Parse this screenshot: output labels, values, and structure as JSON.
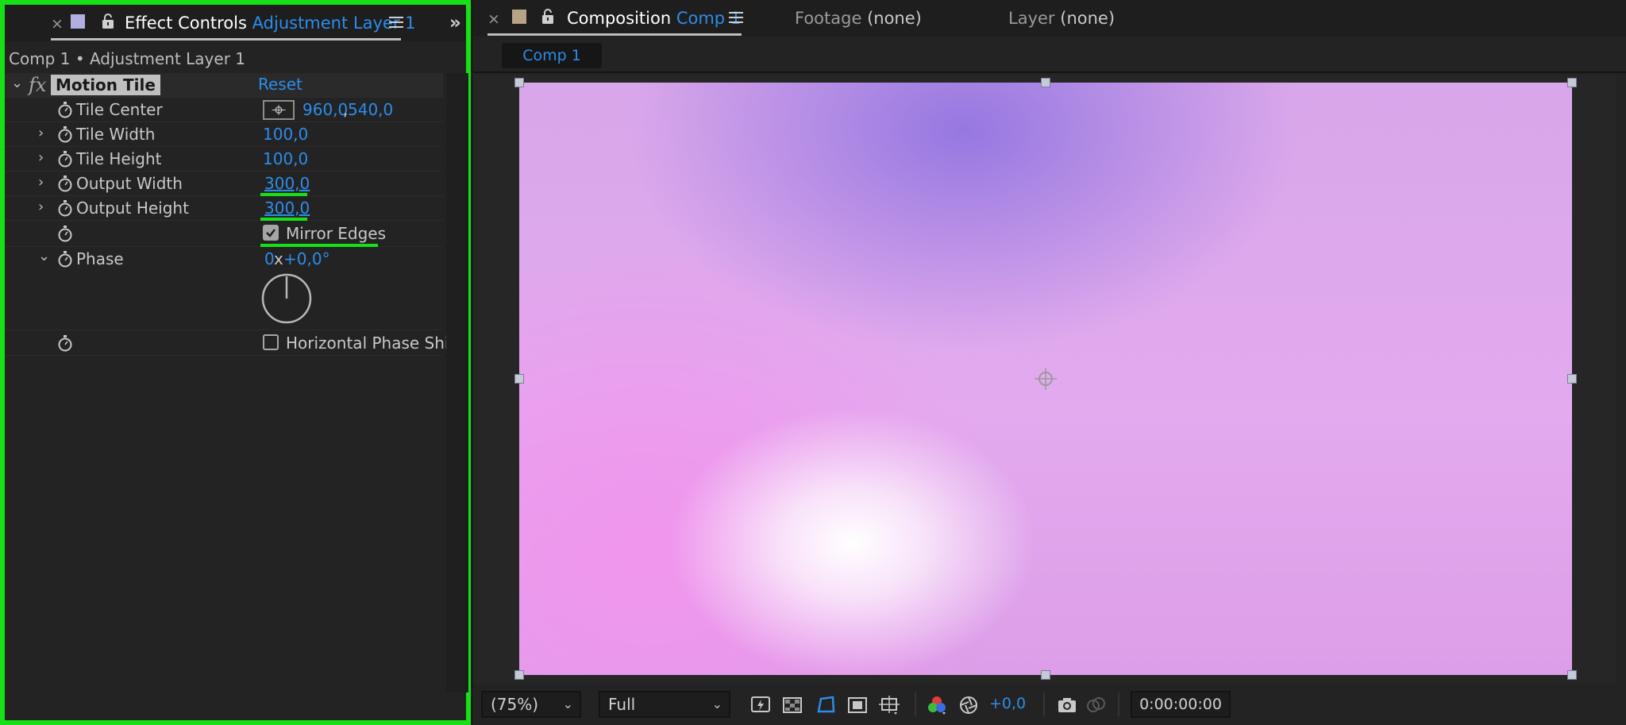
{
  "effect_controls": {
    "tab_close": "×",
    "title_prefix": "Effect Controls",
    "title_layer": "Adjustment Layer 1",
    "layer_path": "Comp 1 • Adjustment Layer 1",
    "overflow": "»",
    "effect": {
      "fx_label": "fx",
      "name": "Motion Tile",
      "reset_label": "Reset"
    },
    "properties": [
      {
        "name": "Tile Center",
        "value_x": "960,0",
        "value_sep": ",",
        "value_y": "540,0"
      },
      {
        "name": "Tile Width",
        "value": "100,0"
      },
      {
        "name": "Tile Height",
        "value": "100,0"
      },
      {
        "name": "Output Width",
        "value": "300,0"
      },
      {
        "name": "Output Height",
        "value": "300,0"
      },
      {
        "name": "",
        "checkbox_label": "Mirror Edges",
        "checked": true
      },
      {
        "name": "Phase",
        "value_rev": "0",
        "value_x": "x",
        "value_deg": "+0,0°"
      },
      {
        "name": "",
        "checkbox_label": "Horizontal Phase Shif",
        "checked": false
      }
    ]
  },
  "composition": {
    "tab_close": "×",
    "title_prefix": "Composition",
    "title_comp": "Comp 1",
    "footage_label": "Footage",
    "footage_value": "(none)",
    "layer_label": "Layer",
    "layer_value": "(none)",
    "subtab": "Comp 1",
    "zoom": "(75%)",
    "resolution": "Full",
    "exposure": "+0,0",
    "timecode": "0:00:00:00"
  },
  "colors": {
    "highlight_border": "#16e016",
    "accent_blue": "#2d8ceb",
    "panel_bg": "#232323",
    "comp_swatch": "#b7a386",
    "layer_swatch": "#b3aee0"
  }
}
